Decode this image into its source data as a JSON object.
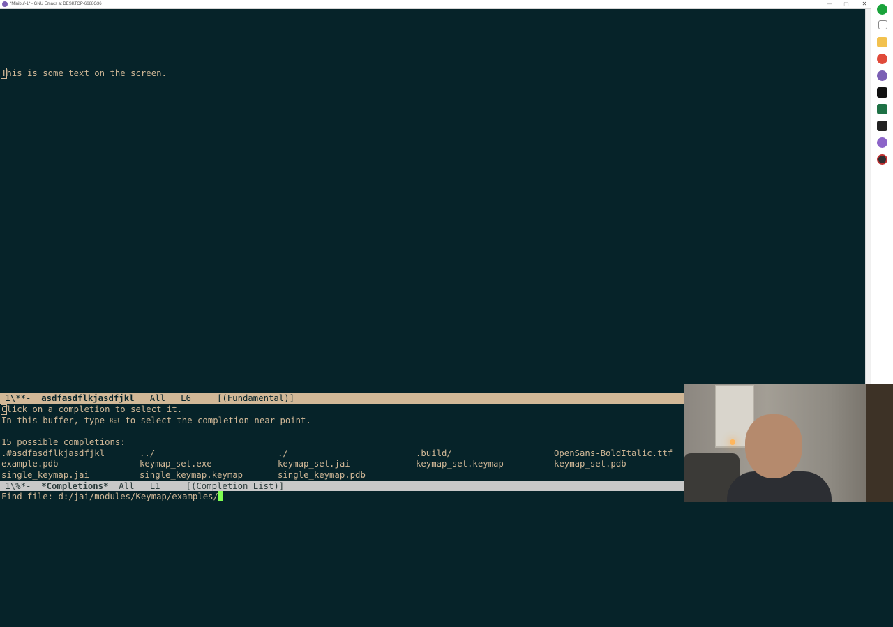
{
  "window": {
    "title": "*Minibuf-1* - GNU Emacs at DESKTOP-6688G36",
    "controls": {
      "minimize": "—",
      "maximize": "▢",
      "close": "✕"
    }
  },
  "buffer": {
    "text_first_char": "T",
    "text_rest": "his is some text on the screen."
  },
  "modeline_top": {
    "status": " 1\\**-  ",
    "buffer_name": "asdfasdflkjasdfjkl",
    "position": "   All   L6     ",
    "mode": "[(Fundamental)]"
  },
  "completions_buffer": {
    "help_first_char": "C",
    "help_line1_rest": "lick on a completion to select it.",
    "help_line2_before": "In this buffer, type ",
    "help_line2_key": "RET",
    "help_line2_after": " to select the completion near point.",
    "count_line": "15 possible completions:",
    "rows": [
      [
        ".#asdfasdflkjasdfjkl",
        "../",
        "./",
        ".build/",
        "OpenSans-BoldItalic.ttf"
      ],
      [
        "example.pdb",
        "keymap_set.exe",
        "keymap_set.jai",
        "keymap_set.keymap",
        "keymap_set.pdb"
      ],
      [
        "single_keymap.jai",
        "single_keymap.keymap",
        "single_keymap.pdb",
        "",
        ""
      ]
    ]
  },
  "modeline_bottom": {
    "status": " 1\\%*-  ",
    "buffer_name": "*Completions*",
    "position": "  All   L1     ",
    "mode": "[(Completion List)]"
  },
  "minibuffer": {
    "prompt": "Find file: ",
    "value": "d:/jai/modules/Keymap/examples/"
  },
  "taskbar_icons": [
    "chrome-green-icon",
    "task-view-icon",
    "file-explorer-icon",
    "chrome-icon",
    "emacs-icon",
    "rider-icon",
    "excel-icon",
    "terminal-icon",
    "emacs-alt-icon",
    "obs-icon"
  ],
  "colors": {
    "background": "#062329",
    "foreground": "#d1b897",
    "modeline": "#d1b897",
    "cursor": "#7fff52"
  }
}
